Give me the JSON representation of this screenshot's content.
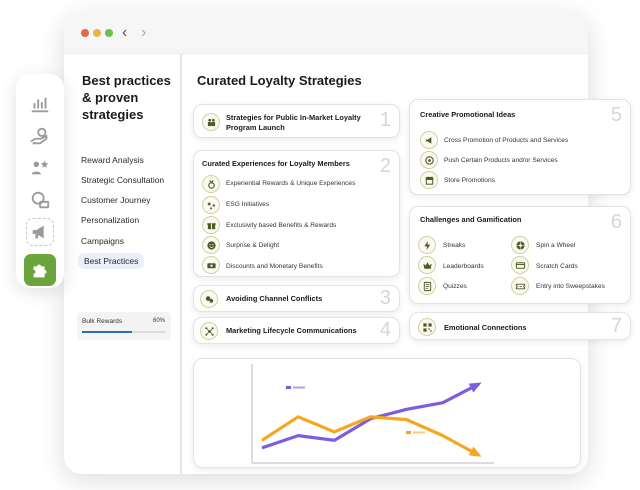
{
  "window": {
    "dots": [
      "#e06a4f",
      "#e9b63d",
      "#6cbf4f"
    ],
    "back_glyph": "‹",
    "forward_glyph": "›"
  },
  "rail": {
    "icons": [
      "bar-chart-icon",
      "hand-money-icon",
      "user-rating-icon",
      "coins-icon",
      "megaphone-icon",
      "puzzle-icon"
    ],
    "active": "puzzle-icon",
    "accent": "#6aa53b"
  },
  "sidebar": {
    "title": "Best practices & proven strategies",
    "items": [
      {
        "label": "Reward Analysis"
      },
      {
        "label": "Strategic Consultation"
      },
      {
        "label": "Customer Journey"
      },
      {
        "label": "Personalization"
      },
      {
        "label": "Campaigns"
      },
      {
        "label": "Best Practices",
        "active": true
      }
    ],
    "bulk": {
      "label": "Bulk Rewards",
      "percent_text": "60%",
      "progress": 0.6
    }
  },
  "main": {
    "title": "Curated Loyalty Strategies",
    "cards": {
      "c1": {
        "num": "1",
        "title": "Strategies for Public In-Market Loyalty Program Launch",
        "icon": "users-icon"
      },
      "c2": {
        "num": "2",
        "title": "Curated Experiences for Loyalty Members",
        "items": [
          {
            "label": "Experiential Rewards & Unique Experiences",
            "icon": "medal-icon"
          },
          {
            "label": "ESG Initiatives",
            "icon": "stars-icon"
          },
          {
            "label": "Exclusivity based Benefits & Rewards",
            "icon": "gift-icon"
          },
          {
            "label": "Surprise & Delight",
            "icon": "smile-icon"
          },
          {
            "label": "Discounts and Monetary Benefits",
            "icon": "money-icon"
          }
        ]
      },
      "c3": {
        "num": "3",
        "title": "Avoiding Channel Conflicts",
        "icon": "conflict-icon"
      },
      "c4": {
        "num": "4",
        "title": "Marketing Lifecycle Communications",
        "icon": "cycle-icon"
      },
      "c5": {
        "num": "5",
        "title": "Creative Promotional Ideas",
        "items": [
          {
            "label": "Cross Promotion of Products and Services",
            "icon": "megaphone-icon"
          },
          {
            "label": "Push Certain Products and/or Services",
            "icon": "target-icon"
          },
          {
            "label": "Store Promotions",
            "icon": "store-icon"
          }
        ]
      },
      "c6": {
        "num": "6",
        "title": "Challenges and Gamification",
        "left": [
          {
            "label": "Streaks",
            "icon": "lightning-icon"
          },
          {
            "label": "Leaderboards",
            "icon": "crown-icon"
          },
          {
            "label": "Quizzes",
            "icon": "quiz-icon"
          }
        ],
        "right": [
          {
            "label": "Spin a Wheel",
            "icon": "wheel-icon"
          },
          {
            "label": "Scratch Cards",
            "icon": "card-icon"
          },
          {
            "label": "Entry into Sweepstakes",
            "icon": "ticket-icon"
          }
        ]
      },
      "c7": {
        "num": "7",
        "title": "Emotional Connections",
        "icon": "qr-icon"
      }
    }
  },
  "chart_data": {
    "type": "line",
    "x": [
      1,
      2,
      3,
      4,
      5,
      6,
      7
    ],
    "series": [
      {
        "color": "#7c5ce0",
        "values": [
          14,
          27,
          22,
          45,
          55,
          62,
          82
        ]
      },
      {
        "color": "#f5a623",
        "values": [
          22,
          47,
          31,
          47,
          44,
          27,
          6
        ]
      }
    ],
    "legend_labels_illegible": true,
    "grid": false,
    "ylim": [
      0,
      100
    ]
  }
}
